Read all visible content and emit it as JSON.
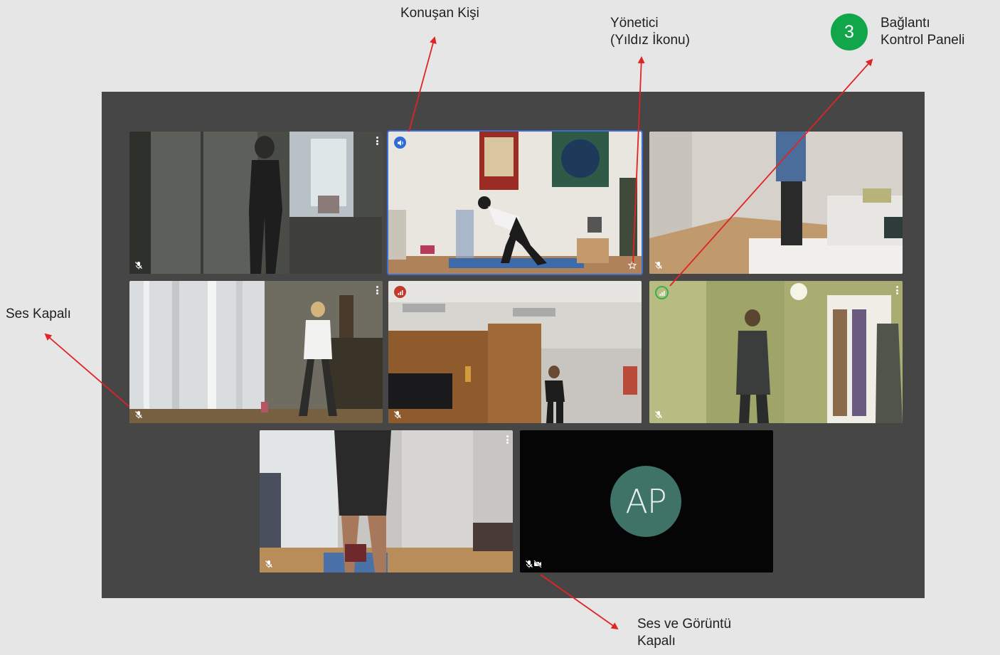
{
  "annotations": {
    "speaker": "Konuşan Kişi",
    "host_line1": "Yönetici",
    "host_line2": "(Yıldız İkonu)",
    "step_number": "3",
    "connection_line1": "Bağlantı",
    "connection_line2": "Kontrol Paneli",
    "muted": "Ses Kapalı",
    "av_off_line1": "Ses ve Görüntü",
    "av_off_line2": "Kapalı"
  },
  "participants": [
    {
      "slot": 1,
      "muted": true,
      "status": "muted"
    },
    {
      "slot": 2,
      "muted": false,
      "status": "speaking",
      "host": true
    },
    {
      "slot": 3,
      "muted": true,
      "status": "muted"
    },
    {
      "slot": 4,
      "muted": true,
      "status": "muted"
    },
    {
      "slot": 5,
      "muted": true,
      "status": "weak-connection"
    },
    {
      "slot": 6,
      "muted": true,
      "status": "good-connection"
    },
    {
      "slot": 7,
      "muted": true,
      "status": "muted"
    },
    {
      "slot": 8,
      "muted": true,
      "camera_off": true,
      "initials": "AP"
    }
  ],
  "colors": {
    "page_background": "#e6e6e7",
    "stage_background": "#464646",
    "active_speaker_border": "#3b6fd6",
    "step_badge": "#12a64a",
    "arrow": "#e02424",
    "avatar": "#3f7367",
    "weak_connection": "#c0392b",
    "good_connection": "#34b24b"
  },
  "icons": [
    "microphone-off-icon",
    "camera-off-icon",
    "star-icon",
    "speaker-icon",
    "signal-bars-icon",
    "more-options-icon"
  ]
}
